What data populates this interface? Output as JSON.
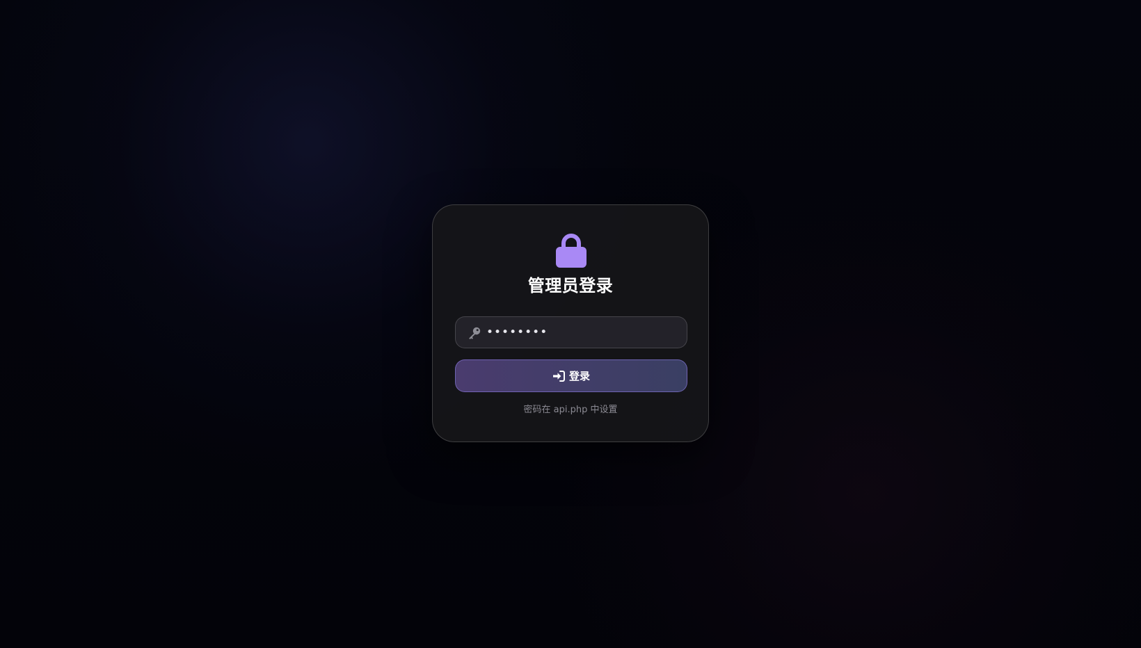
{
  "login": {
    "title": "管理员登录",
    "password_value": "••••••••",
    "password_type": "password",
    "button_label": "登录",
    "hint": "密码在 api.php 中设置"
  },
  "icons": {
    "header": "lock-icon",
    "input": "key-icon",
    "button": "sign-in-icon"
  },
  "colors": {
    "accent": "#a989f5",
    "button_start": "#4a3c6e",
    "button_end": "#3a3f63",
    "card_bg": "#161619",
    "input_bg": "#232229",
    "hint": "#8b8a93"
  }
}
